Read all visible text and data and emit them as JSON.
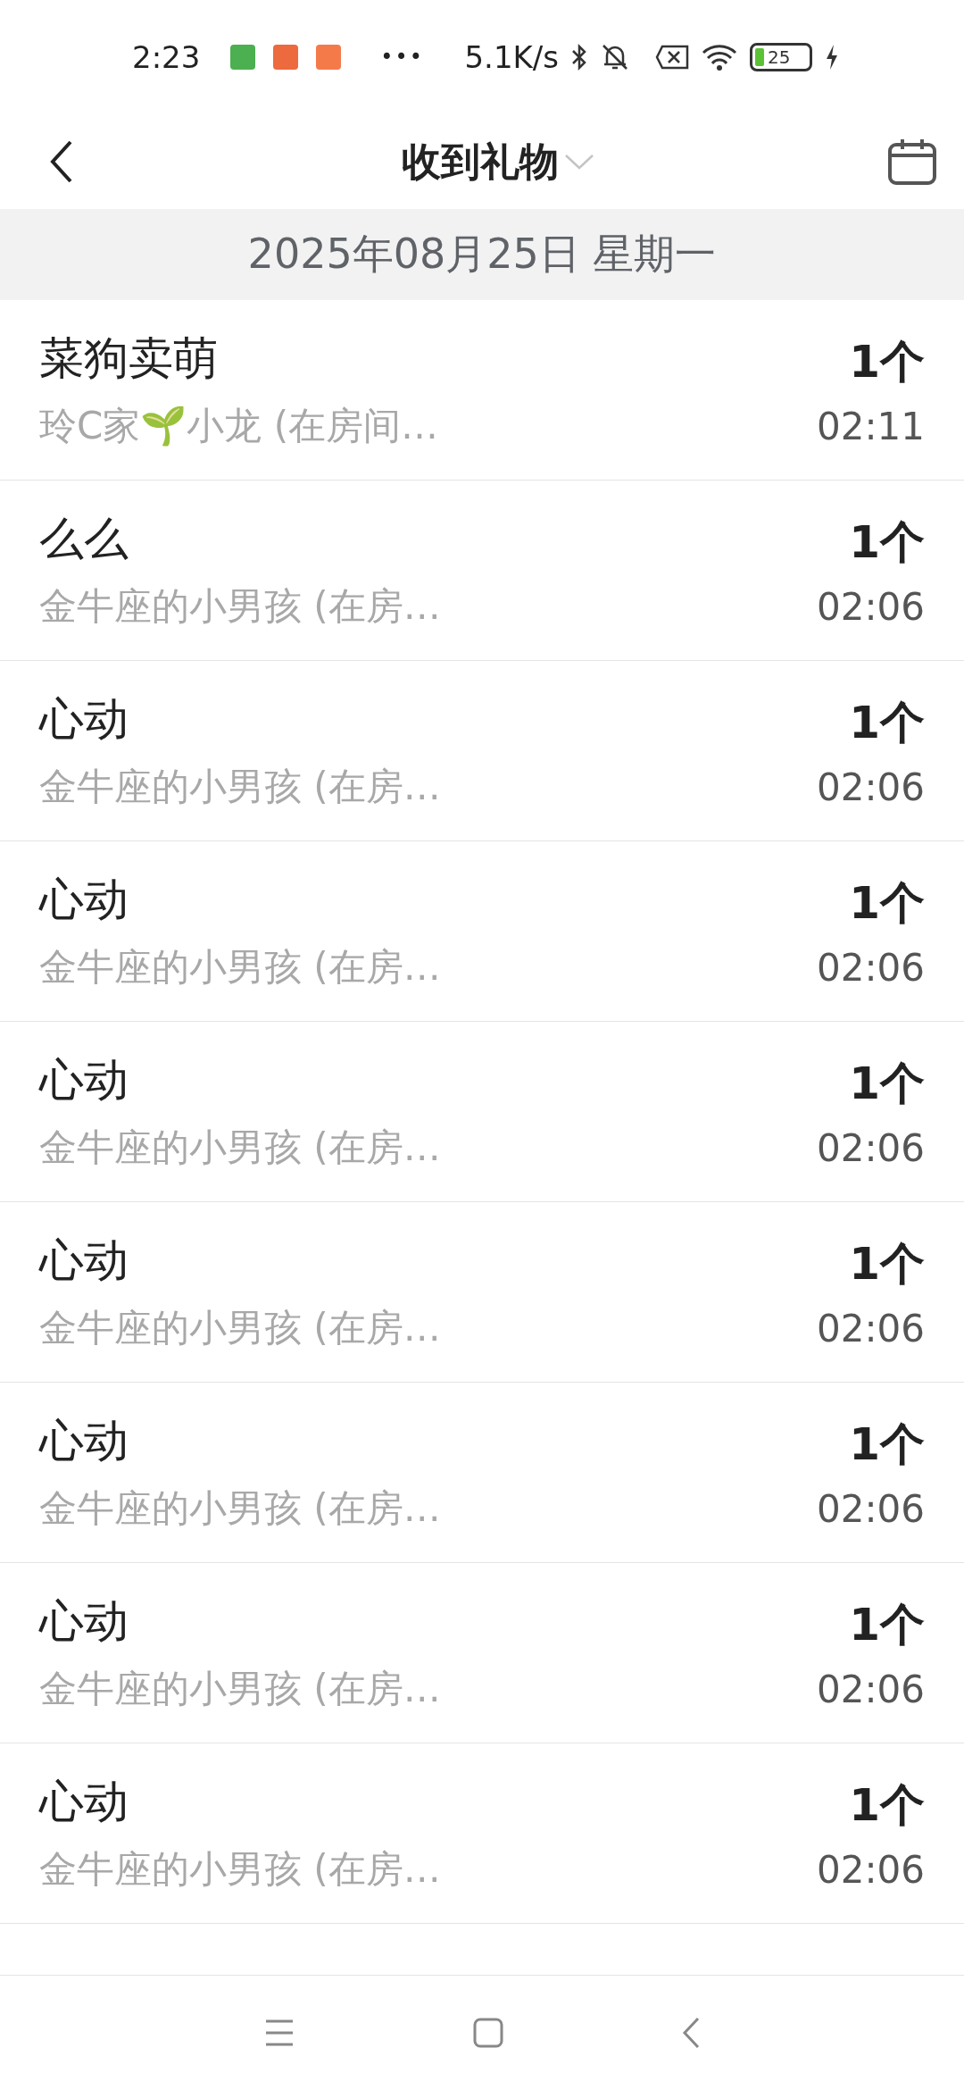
{
  "status_bar": {
    "time": "2:23",
    "more": "•••",
    "net_speed": "5.1K/s",
    "battery": "25"
  },
  "header": {
    "title": "收到礼物"
  },
  "date_band": {
    "label": "2025年08月25日 星期一"
  },
  "gifts": [
    {
      "gift": "菜狗卖萌",
      "sender": "玲C家🌱小龙 (在房间…",
      "count": "1个",
      "time": "02:11"
    },
    {
      "gift": "么么",
      "sender": "金牛座的小男孩 (在房…",
      "count": "1个",
      "time": "02:06"
    },
    {
      "gift": "心动",
      "sender": "金牛座的小男孩 (在房…",
      "count": "1个",
      "time": "02:06"
    },
    {
      "gift": "心动",
      "sender": "金牛座的小男孩 (在房…",
      "count": "1个",
      "time": "02:06"
    },
    {
      "gift": "心动",
      "sender": "金牛座的小男孩 (在房…",
      "count": "1个",
      "time": "02:06"
    },
    {
      "gift": "心动",
      "sender": "金牛座的小男孩 (在房…",
      "count": "1个",
      "time": "02:06"
    },
    {
      "gift": "心动",
      "sender": "金牛座的小男孩 (在房…",
      "count": "1个",
      "time": "02:06"
    },
    {
      "gift": "心动",
      "sender": "金牛座的小男孩 (在房…",
      "count": "1个",
      "time": "02:06"
    },
    {
      "gift": "心动",
      "sender": "金牛座的小男孩 (在房…",
      "count": "1个",
      "time": "02:06"
    }
  ]
}
